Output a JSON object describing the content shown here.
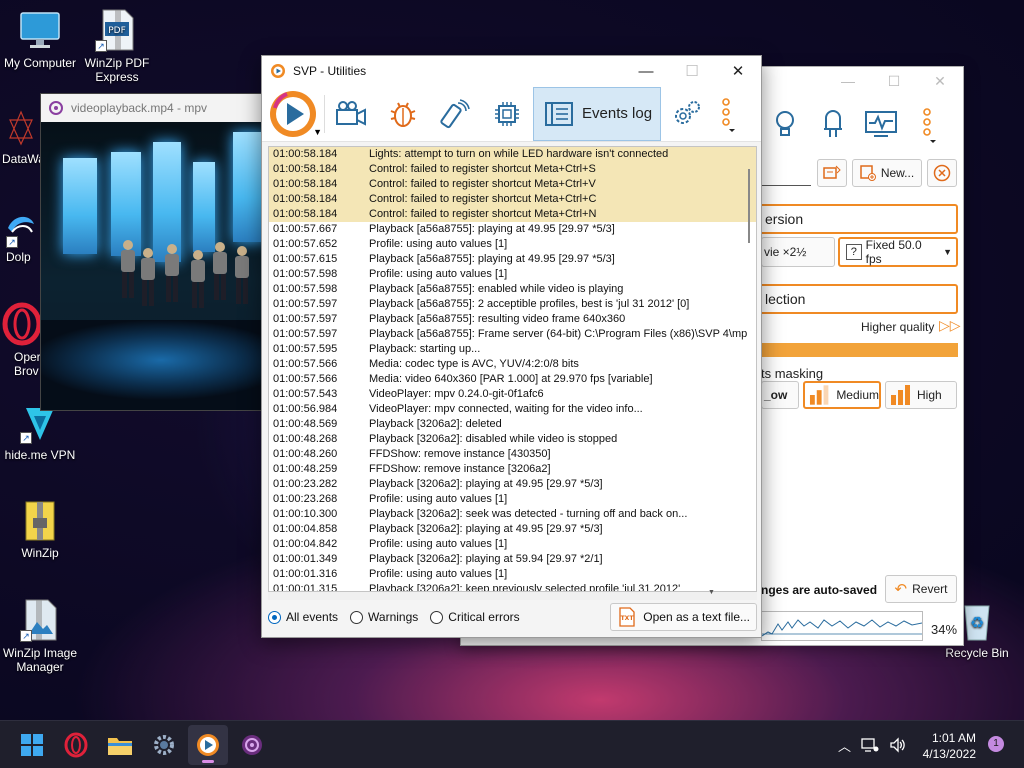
{
  "desktop": {
    "icons": [
      {
        "label": "My Computer"
      },
      {
        "label": "WinZip PDF Express"
      },
      {
        "label": "DataWa"
      },
      {
        "label": "Dolp"
      },
      {
        "label": "Oper Brov"
      },
      {
        "label": "hide.me VPN"
      },
      {
        "label": "WinZip"
      },
      {
        "label": "WinZip Image Manager"
      },
      {
        "label": "Recycle Bin"
      }
    ]
  },
  "mpv": {
    "title": "videoplayback.mp4 - mpv"
  },
  "svp_bg": {
    "new_label": "New...",
    "version_label": "ersion",
    "movie_label": "vie ×2½",
    "fixed_label": "Fixed 50.0 fps",
    "selection_label": "lection",
    "higher_quality": "Higher quality",
    "masking_label": "ts masking",
    "low_label": "_ow",
    "medium_label": "Medium",
    "high_label": "High",
    "autosave_label": "nges are auto-saved",
    "revert_label": "Revert",
    "percent": "34%"
  },
  "svp": {
    "title": "SVP - Utilities",
    "active_tab": "Events log",
    "log": [
      {
        "time": "01:00:58.184",
        "msg": "Lights: attempt to turn on while LED hardware isn't connected",
        "hl": true
      },
      {
        "time": "01:00:58.184",
        "msg": "Control: failed to register shortcut Meta+Ctrl+S",
        "hl": true
      },
      {
        "time": "01:00:58.184",
        "msg": "Control: failed to register shortcut Meta+Ctrl+V",
        "hl": true
      },
      {
        "time": "01:00:58.184",
        "msg": "Control: failed to register shortcut Meta+Ctrl+C",
        "hl": true
      },
      {
        "time": "01:00:58.184",
        "msg": "Control: failed to register shortcut Meta+Ctrl+N",
        "hl": true
      },
      {
        "time": "01:00:57.667",
        "msg": "Playback [a56a8755]: playing at 49.95 [29.97 *5/3]",
        "hl": false
      },
      {
        "time": "01:00:57.652",
        "msg": "Profile: using auto values [1]",
        "hl": false
      },
      {
        "time": "01:00:57.615",
        "msg": "Playback [a56a8755]: playing at 49.95 [29.97 *5/3]",
        "hl": false
      },
      {
        "time": "01:00:57.598",
        "msg": "Profile: using auto values [1]",
        "hl": false
      },
      {
        "time": "01:00:57.598",
        "msg": "Playback [a56a8755]: enabled while video is playing",
        "hl": false
      },
      {
        "time": "01:00:57.597",
        "msg": "Playback [a56a8755]: 2 acceptible profiles, best is 'jul 31 2012' [0]",
        "hl": false
      },
      {
        "time": "01:00:57.597",
        "msg": "Playback [a56a8755]: resulting video frame 640x360",
        "hl": false
      },
      {
        "time": "01:00:57.597",
        "msg": "Playback [a56a8755]: Frame server (64-bit) C:\\Program Files (x86)\\SVP 4\\mp",
        "hl": false
      },
      {
        "time": "01:00:57.595",
        "msg": "Playback: starting up...",
        "hl": false
      },
      {
        "time": "01:00:57.566",
        "msg": "Media: codec type is AVC, YUV/4:2:0/8 bits",
        "hl": false
      },
      {
        "time": "01:00:57.566",
        "msg": "Media: video 640x360 [PAR 1.000] at 29.970 fps [variable]",
        "hl": false
      },
      {
        "time": "01:00:57.543",
        "msg": "VideoPlayer: mpv 0.24.0-git-0f1afc6",
        "hl": false
      },
      {
        "time": "01:00:56.984",
        "msg": "VideoPlayer: mpv connected, waiting for the video info...",
        "hl": false
      },
      {
        "time": "01:00:48.569",
        "msg": "Playback [3206a2]: deleted",
        "hl": false
      },
      {
        "time": "01:00:48.268",
        "msg": "Playback [3206a2]: disabled while video is stopped",
        "hl": false
      },
      {
        "time": "01:00:48.260",
        "msg": "FFDShow: remove instance [430350]",
        "hl": false
      },
      {
        "time": "01:00:48.259",
        "msg": "FFDShow: remove instance [3206a2]",
        "hl": false
      },
      {
        "time": "01:00:23.282",
        "msg": "Playback [3206a2]: playing at 49.95 [29.97 *5/3]",
        "hl": false
      },
      {
        "time": "01:00:23.268",
        "msg": "Profile: using auto values [1]",
        "hl": false
      },
      {
        "time": "01:00:10.300",
        "msg": "Playback [3206a2]: seek was detected - turning off and back on...",
        "hl": false
      },
      {
        "time": "01:00:04.858",
        "msg": "Playback [3206a2]: playing at 49.95 [29.97 *5/3]",
        "hl": false
      },
      {
        "time": "01:00:04.842",
        "msg": "Profile: using auto values [1]",
        "hl": false
      },
      {
        "time": "01:00:01.349",
        "msg": "Playback [3206a2]: playing at 59.94 [29.97 *2/1]",
        "hl": false
      },
      {
        "time": "01:00:01.316",
        "msg": "Profile: using auto values [1]",
        "hl": false
      },
      {
        "time": "01:00:01.315",
        "msg": "Playback [3206a2]: keep previously selected profile 'jul 31 2012'",
        "hl": false
      }
    ],
    "filters": {
      "all": "All events",
      "warnings": "Warnings",
      "critical": "Critical errors"
    },
    "open_text_label": "Open as a text file..."
  },
  "taskbar": {
    "time": "1:01 AM",
    "date": "4/13/2022",
    "notifications": "1"
  },
  "colors": {
    "accent": "#f08a24",
    "log_highlight": "#f4e6b6",
    "tab_active": "#d6e8f6"
  }
}
